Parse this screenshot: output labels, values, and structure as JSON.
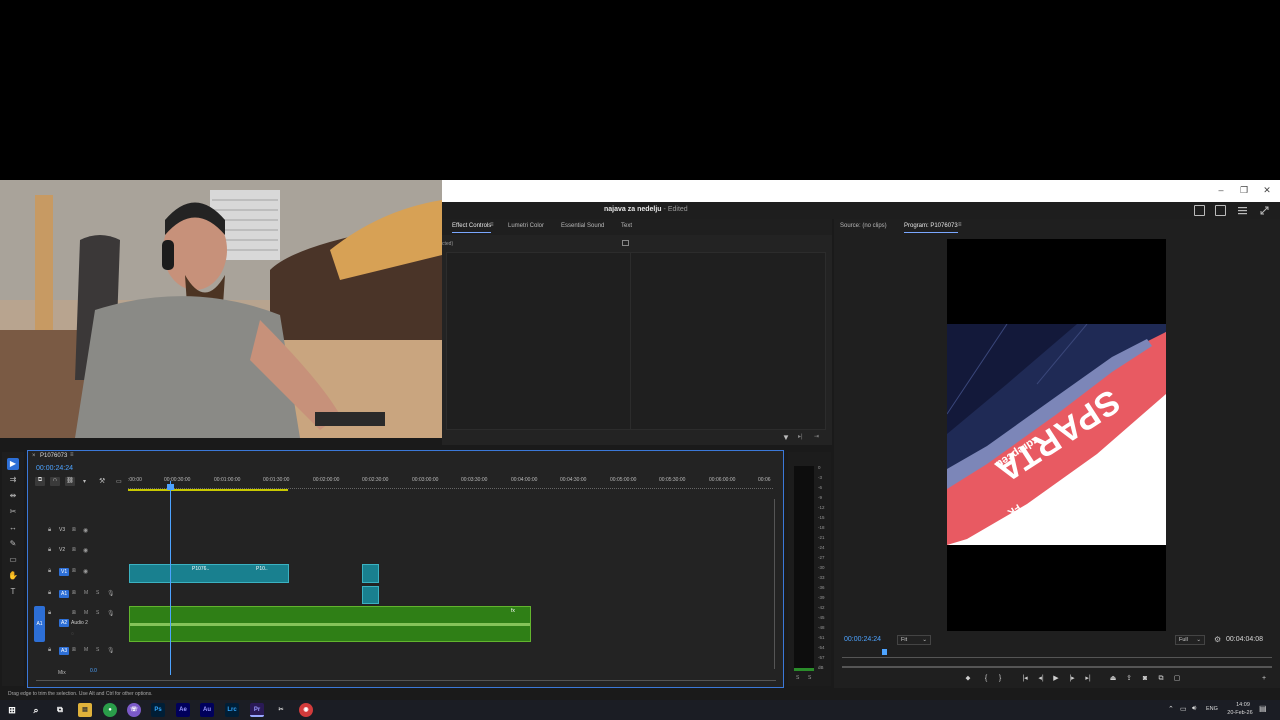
{
  "app": {
    "document_title": "najava za nedelju",
    "edited_suffix": "- Edited"
  },
  "effect_panel": {
    "tabs": [
      "Effect Controls",
      "Lumetri Color",
      "Essential Sound",
      "Text"
    ],
    "active_tab": "Effect Controls",
    "subheader": "cted)"
  },
  "program_monitor": {
    "tabs": [
      "Source: (no clips)",
      "Program: P1076073"
    ],
    "timecode": "00:00:24:24",
    "fit_label": "Fit",
    "quality_label": "Full",
    "duration": "00:04:04:08",
    "frame_text": "SPARTA",
    "frame_subtext": "zdrepceu",
    "frame_corner": "FK"
  },
  "timeline": {
    "sequence_name": "P1076073",
    "timecode": "00:00:24:24",
    "ruler_ticks": [
      ":00:00",
      "00:00:30:00",
      "00:01:00:00",
      "00:01:30:00",
      "00:02:00:00",
      "00:02:30:00",
      "00:03:00:00",
      "00:03:30:00",
      "00:04:00:00",
      "00:04:30:00",
      "00:05:00:00",
      "00:05:30:00",
      "00:06:00:00",
      "00:06"
    ],
    "video_tracks": [
      "V3",
      "V2",
      "V1"
    ],
    "audio_tracks": [
      "A1",
      "A2",
      "A3"
    ],
    "audio2_name": "Audio 2",
    "track_mute": "M",
    "track_solo": "S",
    "clip_v1_label": "P1076..",
    "clip_v1b_label": "P10..",
    "mix_label": "Mix",
    "mix_value": "0.0",
    "source_patch": "A1"
  },
  "meters": {
    "scale": [
      "0",
      "-3",
      "-6",
      "-9",
      "-12",
      "-15",
      "-18",
      "-21",
      "-24",
      "-27",
      "-30",
      "-33",
      "-36",
      "-39",
      "-42",
      "-45",
      "-48",
      "-51",
      "-54",
      "-57",
      "dB"
    ],
    "solo_left": "S",
    "solo_right": "S"
  },
  "status": {
    "hint": "Drag edge to trim the selection. Use Alt and Ctrl for other options."
  },
  "taskbar": {
    "apps": [
      "Ps",
      "Ae",
      "Au",
      "Lrc",
      "Pr"
    ],
    "lang": "ENG",
    "time": "14:09",
    "date": "20-Feb-26"
  },
  "colors": {
    "accent": "#2d6fd6",
    "timecode": "#4da3ff",
    "video_clip": "#19808f",
    "audio_clip": "#2f7f16"
  }
}
